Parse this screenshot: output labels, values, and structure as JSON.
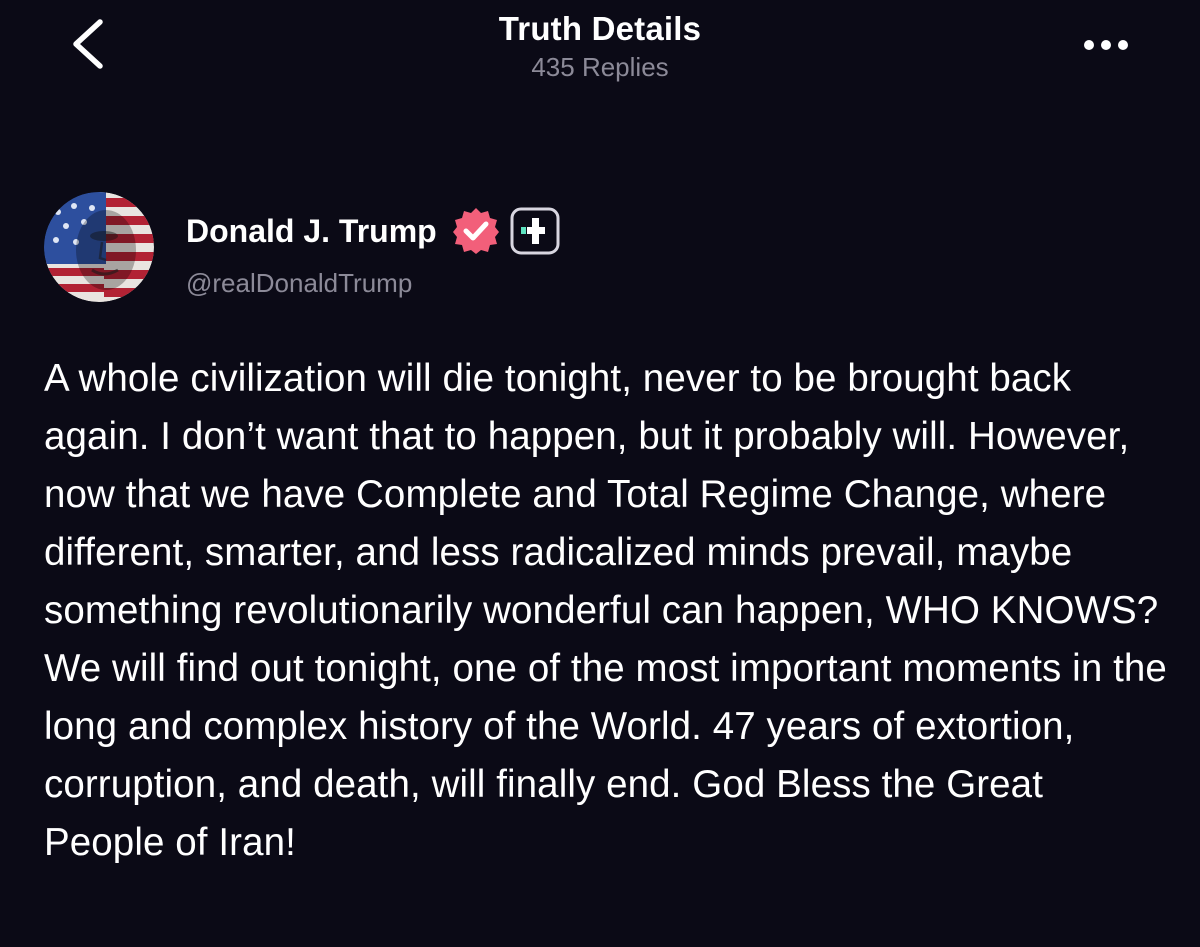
{
  "header": {
    "title": "Truth Details",
    "subtitle": "435 Replies",
    "back_icon": "chevron-left-icon",
    "more_icon": "more-horizontal-icon"
  },
  "author": {
    "display_name": "Donald J. Trump",
    "handle": "@realDonaldTrump",
    "verified_icon": "verified-badge-icon",
    "plus_icon": "truth-plus-icon"
  },
  "post": {
    "text": "A whole civilization will die tonight, never to be brought back again. I don’t want that to happen, but it probably will. However, now that we have Complete and Total Regime Change, where different, smarter, and less radicalized minds prevail, maybe something revolutionarily wonderful can happen, WHO KNOWS? We will find out tonight, one of the most important moments in the long and complex history of the World. 47 years of extortion, corruption, and death, will finally end. God Bless the Great People of Iran!"
  },
  "colors": {
    "background": "#0b0a16",
    "text_primary": "#ffffff",
    "text_secondary": "#8c8a98",
    "verified_badge": "#f25f7a",
    "plus_accent": "#5ee3c0"
  }
}
